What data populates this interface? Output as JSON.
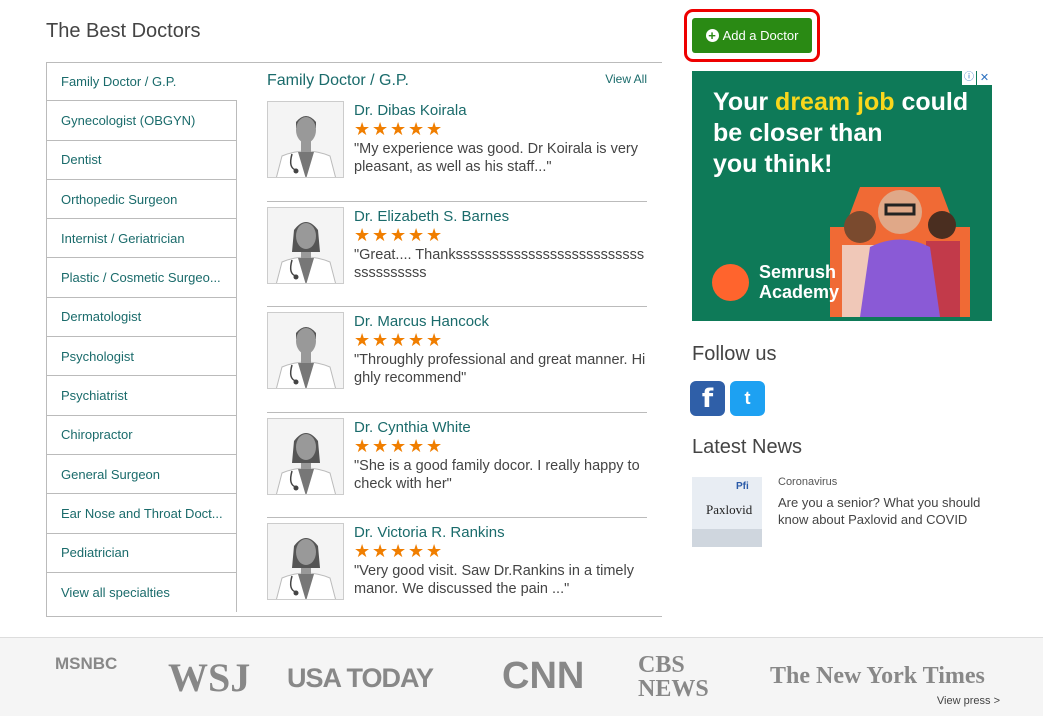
{
  "section_title": "The Best Doctors",
  "specialties": [
    "Family Doctor / G.P.",
    "Gynecologist (OBGYN)",
    "Dentist",
    "Orthopedic Surgeon",
    "Internist / Geriatrician",
    "Plastic / Cosmetic Surgeo...",
    "Dermatologist",
    "Psychologist",
    "Psychiatrist",
    "Chiropractor",
    "General Surgeon",
    "Ear Nose and Throat Doct...",
    "Pediatrician",
    "View all specialties"
  ],
  "panel": {
    "title": "Family Doctor / G.P.",
    "view_all": "View All"
  },
  "doctors": [
    {
      "name": "Dr. Dibas Koirala",
      "gender": "male",
      "rating": 5,
      "review": "\"My experience was good. Dr Koirala is very pleasant, as well as his staff...\""
    },
    {
      "name": "Dr. Elizabeth S. Barnes",
      "gender": "female",
      "rating": 5,
      "review": "\"Great.... Thankssssssssssssssssssssssssssssssssssss"
    },
    {
      "name": "Dr. Marcus Hancock",
      "gender": "male",
      "rating": 5,
      "review": "\"Throughly professional and great manner. Highly recommend\""
    },
    {
      "name": "Dr. Cynthia White",
      "gender": "female",
      "rating": 5,
      "review": "\"She is a good family docor. I really happy to check with her\""
    },
    {
      "name": "Dr. Victoria R. Rankins",
      "gender": "female",
      "rating": 5,
      "review": "\"Very good visit. Saw Dr.Rankins in a timely manor. We discussed the pain ...\""
    }
  ],
  "add_button": {
    "label": "Add a Doctor",
    "icon": "plus-circle-icon"
  },
  "ad": {
    "line1_a": "Your ",
    "line1_b": "dream job",
    "line1_c": " could",
    "line2": "be closer than",
    "line3": "you think!",
    "brand1": "Semrush",
    "brand2": "Academy",
    "info": "ⓘ",
    "close": "✕",
    "bg_color": "#0e7a58",
    "highlight_color": "#f9d71c"
  },
  "follow": {
    "title": "Follow us",
    "facebook": "f",
    "twitter": "t"
  },
  "news": {
    "title": "Latest News",
    "category": "Coronavirus",
    "headline": "Are you a senior? What you should know about Paxlovid and COVID",
    "thumb_text": "Paxlovid",
    "thumb_brand": "Pfi"
  },
  "press": {
    "logos": [
      "MSNBC",
      "WSJ",
      "USA TODAY",
      "CNN",
      "CBS NEWS",
      "The New York Times"
    ],
    "view_press": "View press >"
  },
  "colors": {
    "accent": "#1a6b6b",
    "star": "#f07e00",
    "button": "#2a8a14"
  }
}
